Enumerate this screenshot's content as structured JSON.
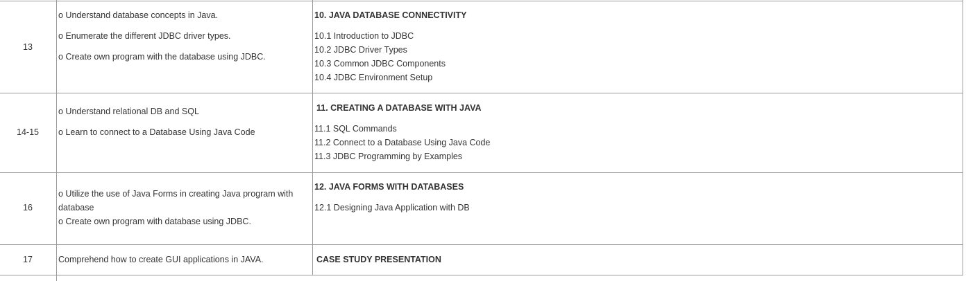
{
  "rows": [
    {
      "week": "13",
      "outcomes": [
        "o Understand database concepts in Java.",
        "o Enumerate the different JDBC driver types.",
        "o Create own program with the database using JDBC."
      ],
      "topic_title": "10. JAVA DATABASE CONNECTIVITY",
      "subtopics": [
        "10.1 Introduction to JDBC",
        "10.2 JDBC Driver Types",
        "10.3 Common JDBC Components",
        "10.4 JDBC Environment Setup"
      ]
    },
    {
      "week": "14-15",
      "outcomes": [
        "o Understand relational DB and SQL",
        "o Learn to connect to a Database Using Java Code"
      ],
      "topic_title": "11. CREATING A DATABASE WITH JAVA",
      "subtopics": [
        "11.1 SQL Commands",
        "11.2 Connect to a Database Using Java Code",
        "11.3 JDBC Programming by Examples"
      ]
    },
    {
      "week": "16",
      "outcomes": [
        "o   Utilize the use of Java Forms in creating Java program with",
        "database",
        "o   Create own program with database using JDBC."
      ],
      "topic_title": "12. JAVA FORMS WITH DATABASES",
      "subtopics": [
        "12.1 Designing Java Application with DB"
      ]
    },
    {
      "week": "17",
      "outcomes": [
        "Comprehend how to create GUI applications in JAVA."
      ],
      "topic_title": "CASE STUDY PRESENTATION",
      "subtopics": []
    }
  ]
}
